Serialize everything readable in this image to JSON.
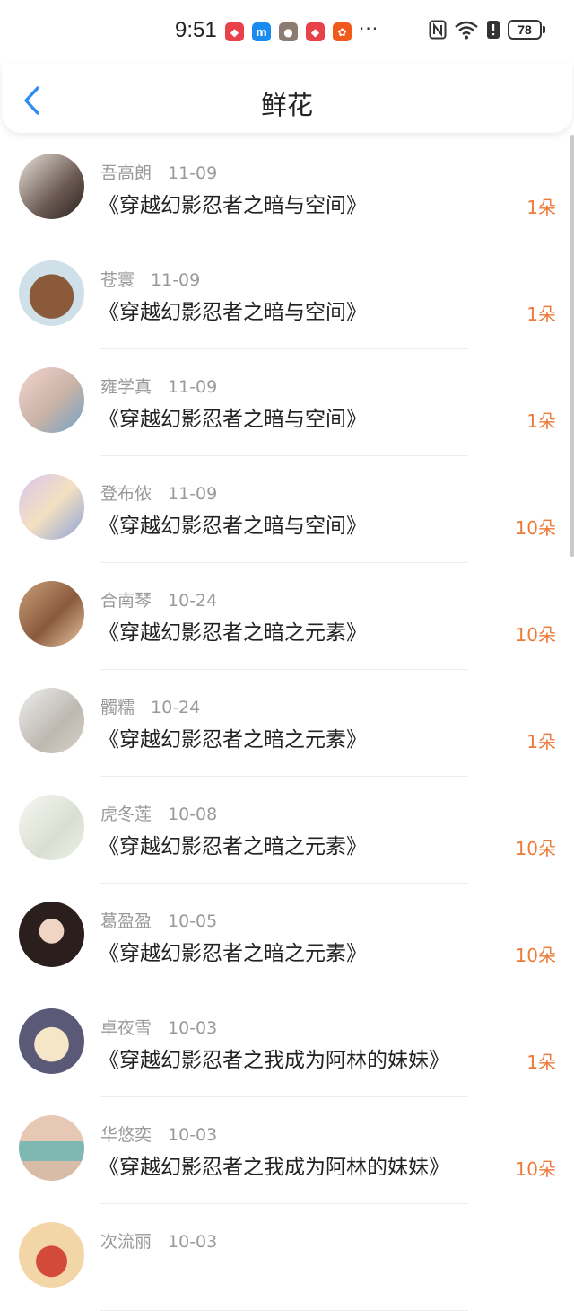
{
  "status_bar": {
    "time": "9:51",
    "battery": "78",
    "app_icons": [
      {
        "name": "huawei-mall-icon",
        "color": "#e8414a",
        "glyph": "◆"
      },
      {
        "name": "m-app-icon",
        "color": "#1a8cf0",
        "glyph": "m"
      },
      {
        "name": "avatar-notification-icon",
        "color": "#8b7b70",
        "glyph": "●"
      },
      {
        "name": "huawei-mall-icon-2",
        "color": "#e8414a",
        "glyph": "◆"
      },
      {
        "name": "kuaishou-icon",
        "color": "#f05a1a",
        "glyph": "✿"
      }
    ],
    "more": "···"
  },
  "header": {
    "title": "鲜花"
  },
  "colors": {
    "accent": "#2f8cf0",
    "count": "#ee7a3a"
  },
  "items": [
    {
      "name": "吾高朗",
      "date": "11-09",
      "book": "《穿越幻影忍者之暗与空间》",
      "count": "1朵",
      "avatar_bg": "linear-gradient(135deg,#e9e3dc 0%,#6b5a52 60%,#2a2220 100%)"
    },
    {
      "name": "苍寰",
      "date": "11-09",
      "book": "《穿越幻影忍者之暗与空间》",
      "count": "1朵",
      "avatar_bg": "radial-gradient(circle at 50% 55%,#8a5a3a 0 45%,#cfe0e8 46%)"
    },
    {
      "name": "雍学真",
      "date": "11-09",
      "book": "《穿越幻影忍者之暗与空间》",
      "count": "1朵",
      "avatar_bg": "linear-gradient(135deg,#f3d6cf,#c9b2a6 55%,#6fa3c7)"
    },
    {
      "name": "登布侬",
      "date": "11-09",
      "book": "《穿越幻影忍者之暗与空间》",
      "count": "10朵",
      "avatar_bg": "linear-gradient(135deg,#d8c6ef,#f4e0c0 50%,#8fa3d8)"
    },
    {
      "name": "合南琴",
      "date": "10-24",
      "book": "《穿越幻影忍者之暗之元素》",
      "count": "10朵",
      "avatar_bg": "linear-gradient(135deg,#caa07a,#8a5a3e 55%,#e9c7a2)"
    },
    {
      "name": "髑糯",
      "date": "10-24",
      "book": "《穿越幻影忍者之暗之元素》",
      "count": "1朵",
      "avatar_bg": "linear-gradient(135deg,#eeeeee,#bdb8b0 60%,#d9d2c8)"
    },
    {
      "name": "虎冬莲",
      "date": "10-08",
      "book": "《穿越幻影忍者之暗之元素》",
      "count": "10朵",
      "avatar_bg": "linear-gradient(135deg,#f7f7f2,#d9dfd2 60%,#eef2ea)"
    },
    {
      "name": "葛盈盈",
      "date": "10-05",
      "book": "《穿越幻影忍者之暗之元素》",
      "count": "10朵",
      "avatar_bg": "radial-gradient(circle at 50% 45%,#f0d5c5 0 25%,#2a1f1d 26%)"
    },
    {
      "name": "卓夜雪",
      "date": "10-03",
      "book": "《穿越幻影忍者之我成为阿林的妹妹》",
      "count": "1朵",
      "avatar_bg": "radial-gradient(circle at 50% 55%,#f5e6c8 0 35%,#5a5a78 36%)"
    },
    {
      "name": "华悠奕",
      "date": "10-03",
      "book": "《穿越幻影忍者之我成为阿林的妹妹》",
      "count": "10朵",
      "avatar_bg": "linear-gradient(180deg,#e6c8b5 0 40%,#7fb8b0 40% 70%,#d9bca8 70%)"
    },
    {
      "name": "次流丽",
      "date": "10-03",
      "book": "",
      "count": "",
      "avatar_bg": "radial-gradient(circle at 50% 60%,#d44a3a 0 30%,#f2d6a8 31%)"
    }
  ]
}
